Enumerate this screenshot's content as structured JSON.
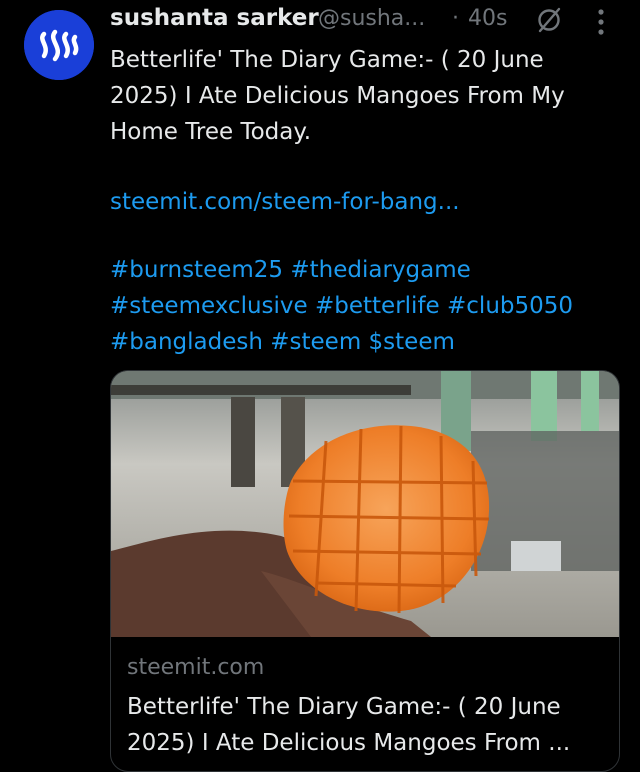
{
  "tweet": {
    "display_name": "sushanta sarker",
    "handle": "@susha...",
    "separator": "·",
    "time": "40s",
    "text": "Betterlife' The Diary Game:- ( 20 June 2025) I Ate Delicious Mangoes From My Home Tree Today.",
    "link": "steemit.com/steem-for-bang...",
    "hashtags": [
      "#burnsteem25",
      "#thediarygame",
      "#steemexclusive",
      "#betterlife",
      "#club5050",
      "#bangladesh",
      "#steem",
      "$steem"
    ]
  },
  "card": {
    "domain": "steemit.com",
    "title": "Betterlife' The Diary Game:- ( 20 June 2025) I Ate Delicious Mangoes From ..."
  },
  "icons": {
    "avatar": "steem-logo-icon",
    "grok": "grok-icon",
    "more": "more-options-icon"
  },
  "colors": {
    "background": "#000000",
    "text": "#e7e9ea",
    "muted": "#71767b",
    "link": "#1d9bf0",
    "avatar_bg": "#1a3fd8"
  }
}
